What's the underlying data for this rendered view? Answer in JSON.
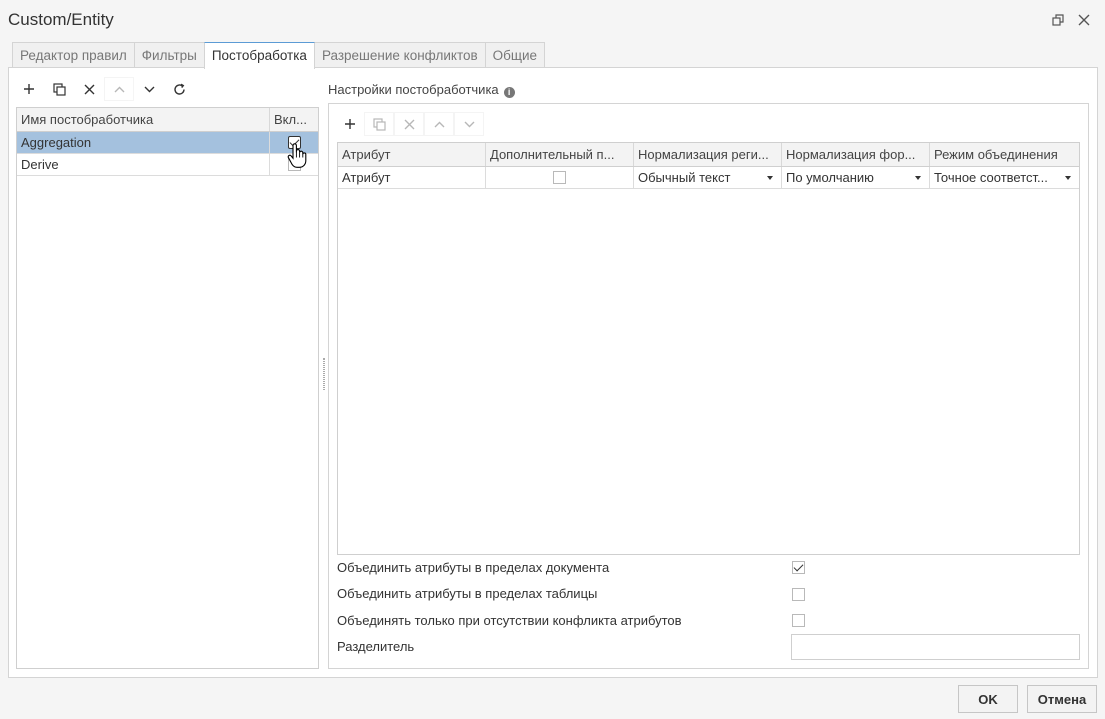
{
  "window": {
    "title": "Custom/Entity",
    "restore_icon": "restore-icon",
    "close_icon": "close-icon"
  },
  "tabs": [
    {
      "label": "Редактор правил",
      "active": false
    },
    {
      "label": "Фильтры",
      "active": false
    },
    {
      "label": "Постобработка",
      "active": true
    },
    {
      "label": "Разрешение конфликтов",
      "active": false
    },
    {
      "label": "Общие",
      "active": false
    }
  ],
  "left_toolbar": [
    "add-icon",
    "copy-icon",
    "delete-icon",
    "move-up-icon",
    "move-down-icon",
    "refresh-icon"
  ],
  "postprocessors": {
    "columns": [
      "Имя постобработчика",
      "Вкл..."
    ],
    "rows": [
      {
        "name": "Aggregation",
        "enabled": true,
        "selected": true
      },
      {
        "name": "Derive",
        "enabled": false,
        "selected": false
      }
    ]
  },
  "settings": {
    "label": "Настройки постобработчика",
    "info_icon": "info-icon",
    "toolbar": [
      "add-icon",
      "copy-icon",
      "delete-icon",
      "move-up-icon",
      "move-down-icon"
    ],
    "columns": [
      "Атрибут",
      "Дополнительный п...",
      "Нормализация реги...",
      "Нормализация фор...",
      "Режим объединения"
    ],
    "rows": [
      {
        "attribute": "Атрибут",
        "additional": false,
        "case_norm": "Обычный текст",
        "form_norm": "По умолчанию",
        "merge_mode": "Точное соответст..."
      }
    ]
  },
  "options": {
    "merge_in_document": {
      "label": "Объединить атрибуты в пределах документа",
      "checked": true
    },
    "merge_in_table": {
      "label": "Объединить атрибуты в пределах таблицы",
      "checked": false
    },
    "merge_no_conflict": {
      "label": "Объединять только при отсутствии конфликта атрибутов",
      "checked": false
    },
    "separator": {
      "label": "Разделитель",
      "value": ""
    }
  },
  "buttons": {
    "ok": "OK",
    "cancel": "Отмена"
  },
  "colors": {
    "selection": "#a4c1de",
    "active_tab_accent": "#5b9bd5"
  }
}
